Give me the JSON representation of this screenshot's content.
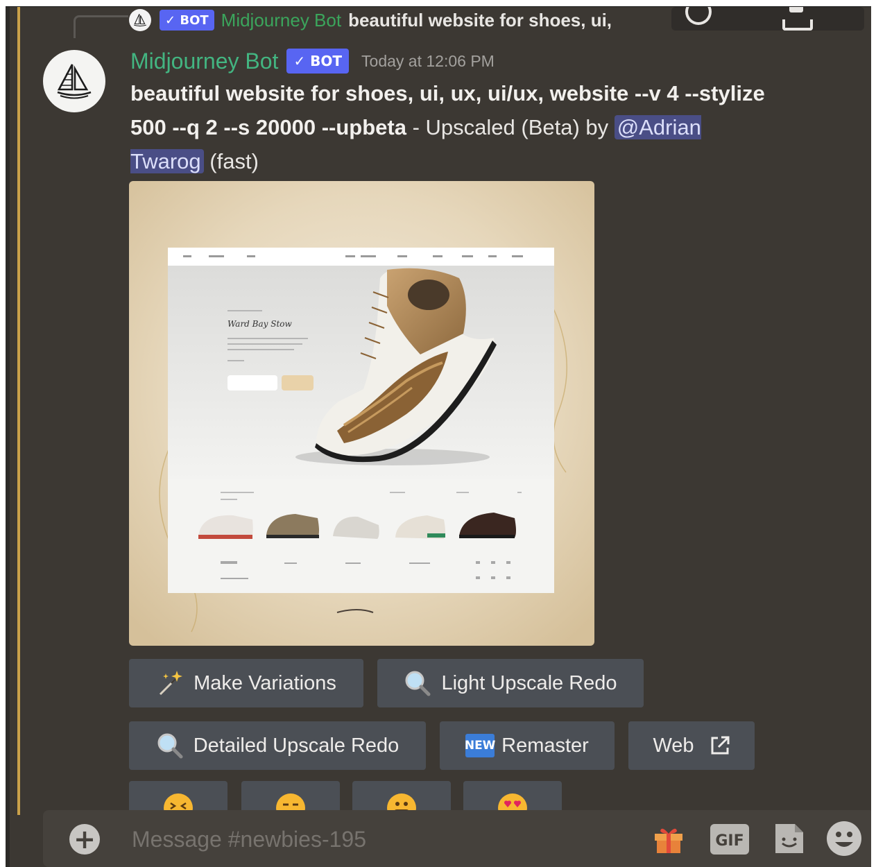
{
  "reply": {
    "bot_tag": "✓ BOT",
    "author": "Midjourney Bot",
    "text": "beautiful website for shoes, ui,"
  },
  "message": {
    "author": "Midjourney Bot",
    "bot_tag": "✓ BOT",
    "timestamp": "Today at 12:06 PM",
    "prompt": "beautiful website for shoes, ui, ux, ui/ux, website --v 4 --stylize 500 --q 2 --s 20000 --upbeta",
    "separator": " - ",
    "suffix": "Upscaled (Beta) by ",
    "mention": "@Adrian Twarog",
    "speed": " (fast)"
  },
  "buttons": {
    "make_variations": "Make Variations",
    "light_upscale_redo": "Light Upscale Redo",
    "detailed_upscale_redo": "Detailed Upscale Redo",
    "new_badge": "NEW",
    "remaster": "Remaster",
    "web": "Web"
  },
  "reactions": [
    "confounded-face",
    "expressionless-face",
    "grimacing-face",
    "heart-eyes-face"
  ],
  "composer": {
    "placeholder": "Message #newbies-195",
    "gif_label": "GIF"
  },
  "colors": {
    "background": "#3c3833",
    "bot_tag": "#5865f2",
    "author_green": "#43b581",
    "mention_bg": "#4a4e86",
    "button": "#4b4f55",
    "accent_line": "#caa14a"
  }
}
